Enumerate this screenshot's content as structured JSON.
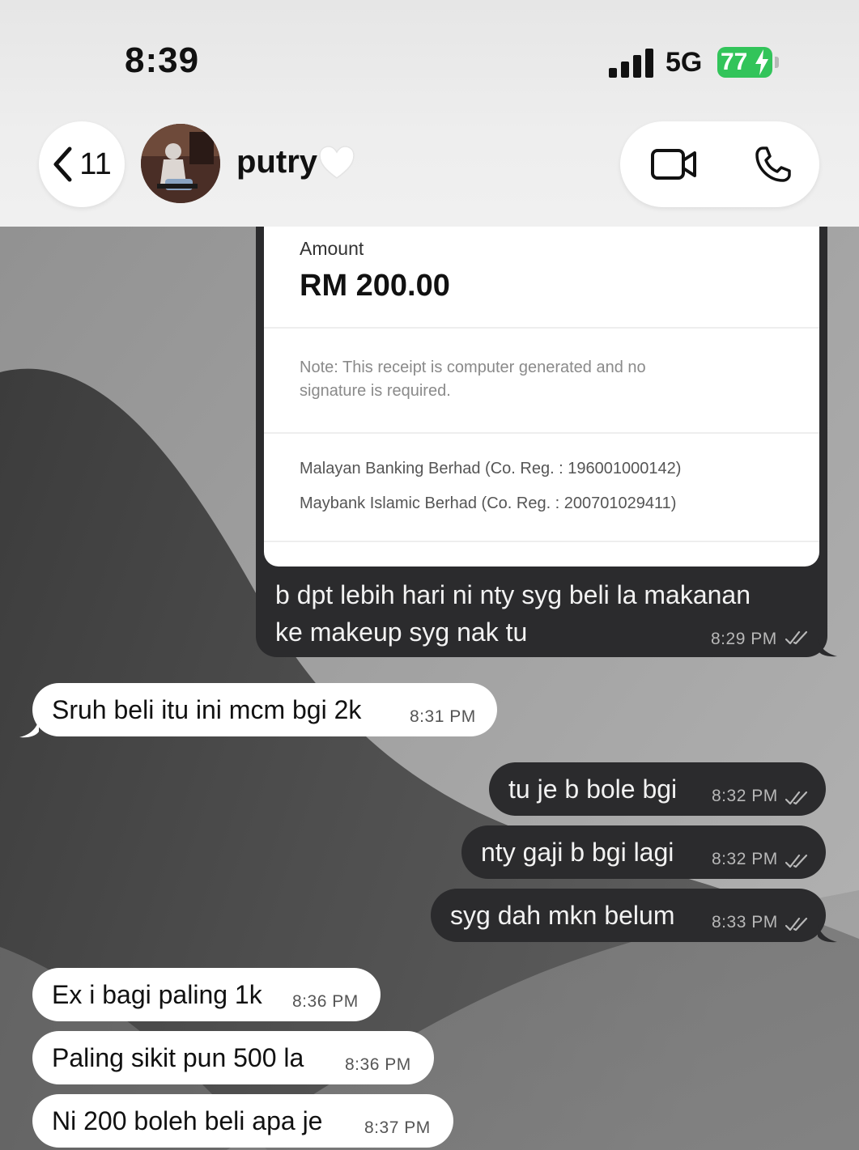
{
  "status_bar": {
    "time": "8:39",
    "network": "5G",
    "battery_level": "77"
  },
  "header": {
    "back_count": "11",
    "contact_name": "putry",
    "icons": [
      "chevron-left-icon",
      "white-heart-icon",
      "video-call-icon",
      "phone-icon"
    ]
  },
  "receipt": {
    "amount_label": "Amount",
    "amount": "RM 200.00",
    "note_line1": "Note: This receipt is computer generated and no",
    "note_line2": "signature is required.",
    "company1": "Malayan Banking Berhad (Co. Reg. : 196001000142)",
    "company2": "Maybank Islamic Berhad (Co. Reg. : 200701029411)",
    "caption_line1": "b dpt lebih hari ni nty syg beli la makanan",
    "caption_line2": "ke makeup syg nak tu",
    "caption_time": "8:29 PM"
  },
  "messages": [
    {
      "direction": "in",
      "text": "Sruh beli itu ini mcm bgi 2k",
      "time": "8:31 PM"
    },
    {
      "direction": "out",
      "text": "tu je b bole bgi",
      "time": "8:32 PM"
    },
    {
      "direction": "out",
      "text": "nty gaji b bgi lagi",
      "time": "8:32 PM"
    },
    {
      "direction": "out",
      "text": "syg dah mkn belum",
      "time": "8:33 PM"
    },
    {
      "direction": "in",
      "text": "Ex i bagi paling 1k",
      "time": "8:36 PM"
    },
    {
      "direction": "in",
      "text": "Paling sikit pun 500 la",
      "time": "8:36 PM"
    },
    {
      "direction": "in",
      "text": "Ni 200 boleh beli apa je",
      "time": "8:37 PM"
    }
  ],
  "colors": {
    "outgoing_bubble": "#2b2b2d",
    "incoming_bubble": "#ffffff",
    "battery": "#32c45a"
  }
}
